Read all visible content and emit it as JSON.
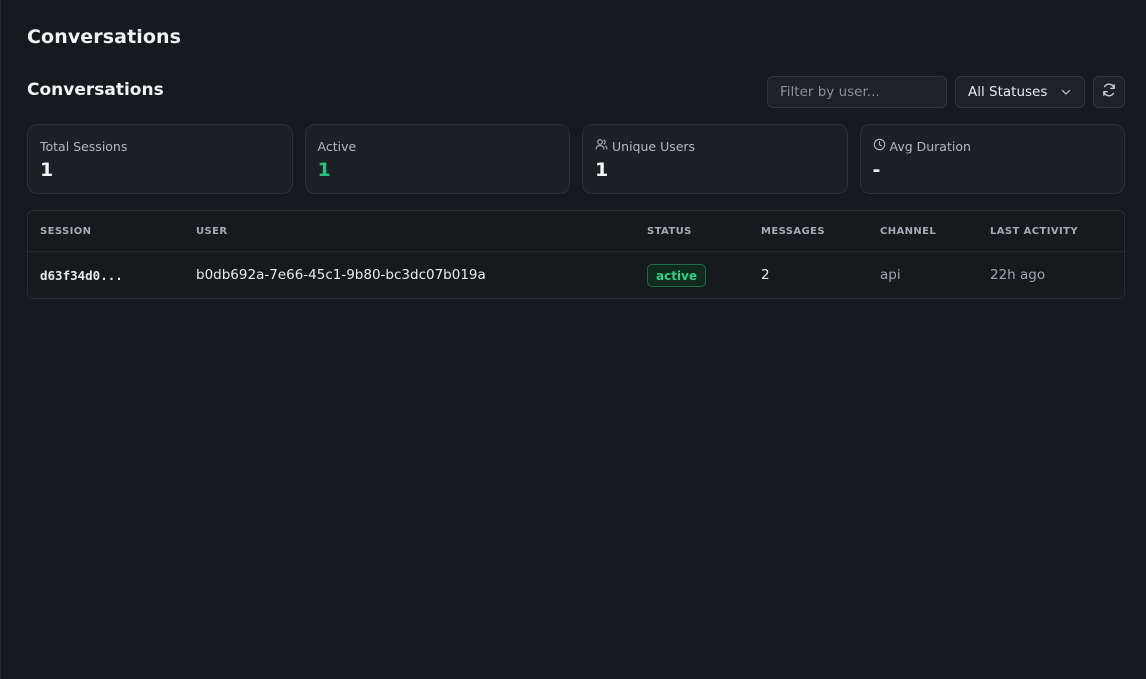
{
  "page": {
    "title": "Conversations"
  },
  "section": {
    "title": "Conversations"
  },
  "filters": {
    "user_placeholder": "Filter by user...",
    "status_selected": "All Statuses"
  },
  "stats": [
    {
      "label": "Total Sessions",
      "value": "1",
      "icon": null
    },
    {
      "label": "Active",
      "value": "1",
      "icon": null,
      "value_color": "#22c27a"
    },
    {
      "label": "Unique Users",
      "value": "1",
      "icon": "users-icon"
    },
    {
      "label": "Avg Duration",
      "value": "-",
      "icon": "clock-icon"
    }
  ],
  "table": {
    "columns": [
      "SESSION",
      "USER",
      "STATUS",
      "MESSAGES",
      "CHANNEL",
      "LAST ACTIVITY"
    ],
    "rows": [
      {
        "session": "d63f34d0...",
        "user": "b0db692a-7e66-45c1-9b80-bc3dc07b019a",
        "status": "active",
        "messages": "2",
        "channel": "api",
        "last_activity": "22h ago"
      }
    ]
  },
  "colors": {
    "background": "#16191d",
    "accent_green": "#22c27a",
    "card": "#1c2025"
  }
}
